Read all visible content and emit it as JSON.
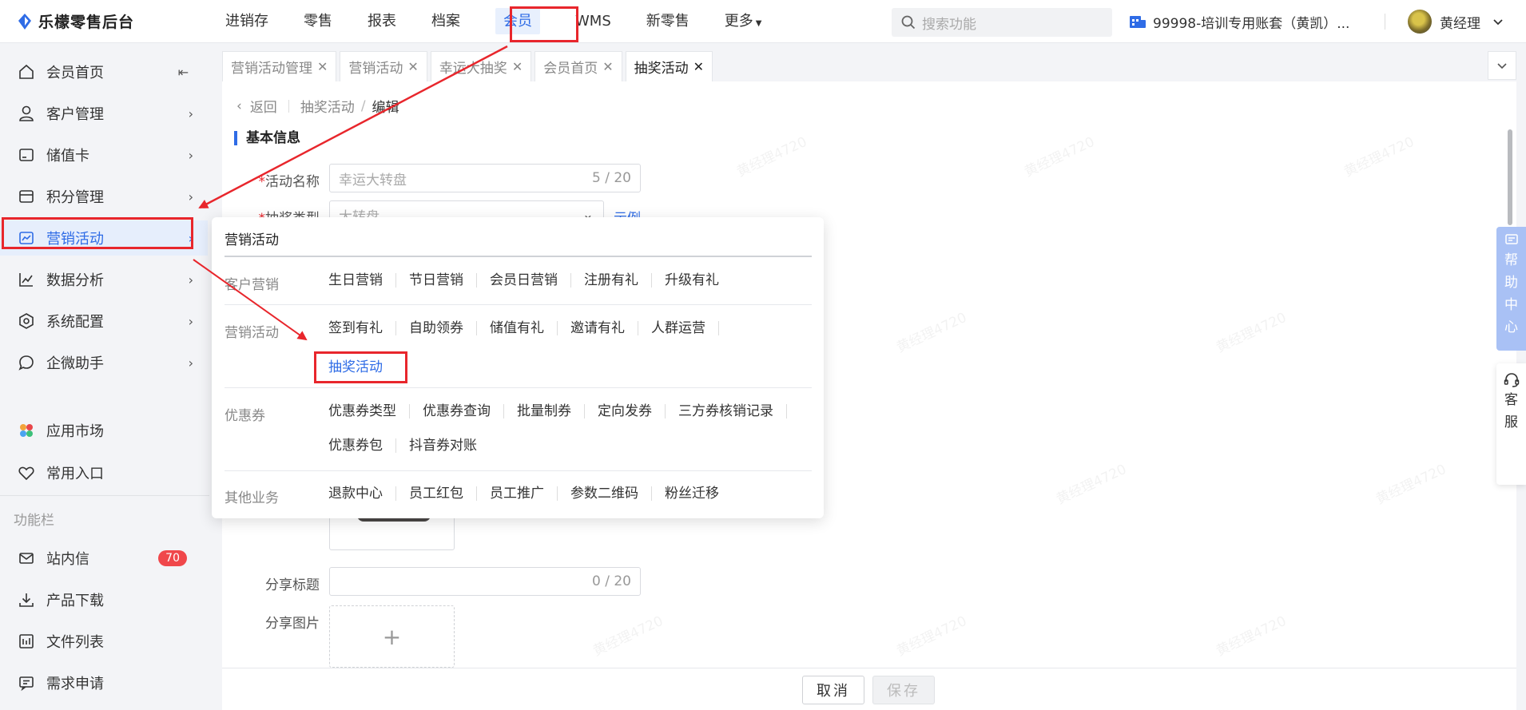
{
  "app": {
    "title": "乐檬零售后台"
  },
  "topnav": [
    {
      "label": "进销存"
    },
    {
      "label": "零售"
    },
    {
      "label": "报表"
    },
    {
      "label": "档案"
    },
    {
      "label": "会员"
    },
    {
      "label": "WMS"
    },
    {
      "label": "新零售"
    },
    {
      "label": "更多"
    }
  ],
  "search": {
    "placeholder": "搜索功能"
  },
  "account": {
    "name": "99998-培训专用账套（黄凯）..."
  },
  "user": {
    "name": "黄经理"
  },
  "sidebar": {
    "items": [
      {
        "label": "会员首页"
      },
      {
        "label": "客户管理"
      },
      {
        "label": "储值卡"
      },
      {
        "label": "积分管理"
      },
      {
        "label": "营销活动"
      },
      {
        "label": "数据分析"
      },
      {
        "label": "系统配置"
      },
      {
        "label": "企微助手"
      }
    ],
    "extras": [
      {
        "label": "应用市场"
      },
      {
        "label": "常用入口"
      }
    ],
    "section_label": "功能栏",
    "tools": [
      {
        "label": "站内信",
        "badge": "70"
      },
      {
        "label": "产品下载"
      },
      {
        "label": "文件列表"
      },
      {
        "label": "需求申请"
      }
    ]
  },
  "tabs": [
    {
      "label": "营销活动管理"
    },
    {
      "label": "营销活动"
    },
    {
      "label": "幸运大抽奖"
    },
    {
      "label": "会员首页"
    },
    {
      "label": "抽奖活动"
    }
  ],
  "breadcrumb": {
    "back": "返回",
    "parent": "抽奖活动",
    "current": "编辑",
    "separator": "/"
  },
  "form": {
    "section_title": "基本信息",
    "activity_name_label": "活动名称",
    "activity_name_value": "幸运大转盘",
    "activity_name_count": "5 / 20",
    "lottery_type_label": "抽奖类型",
    "lottery_type_value": "大转盘",
    "example_link": "示例",
    "share_title_label": "分享标题",
    "share_title_count": "0 / 20",
    "share_image_label": "分享图片",
    "upload_plus": "+"
  },
  "flyout": {
    "title": "营销活动",
    "groups": [
      {
        "category": "客户营销",
        "items": [
          "生日营销",
          "节日营销",
          "会员日营销",
          "注册有礼",
          "升级有礼"
        ]
      },
      {
        "category": "营销活动",
        "items": [
          "签到有礼",
          "自助领券",
          "储值有礼",
          "邀请有礼",
          "人群运营"
        ],
        "active": "抽奖活动"
      },
      {
        "category": "优惠券",
        "items": [
          "优惠券类型",
          "优惠券查询",
          "批量制券",
          "定向发券",
          "三方券核销记录"
        ],
        "items2": [
          "优惠券包",
          "抖音券对账"
        ]
      },
      {
        "category": "其他业务",
        "items": [
          "退款中心",
          "员工红包",
          "员工推广",
          "参数二维码",
          "粉丝迁移"
        ]
      }
    ]
  },
  "buttons": {
    "cancel": "取消",
    "save": "保存"
  },
  "help": {
    "chars": [
      "帮",
      "助",
      "中",
      "心"
    ]
  },
  "service": {
    "chars": [
      "客",
      "服"
    ]
  },
  "watermark": "黄经理4720",
  "colors": {
    "accent": "#2f6ce6",
    "annotation_red": "#e8262c",
    "badge": "#f0474b"
  }
}
